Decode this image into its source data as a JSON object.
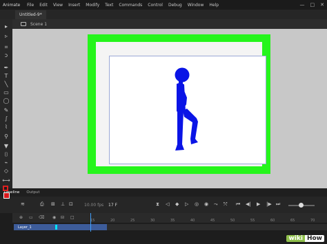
{
  "menu": {
    "app_name": "Animate",
    "items": [
      "File",
      "Edit",
      "View",
      "Insert",
      "Modify",
      "Text",
      "Commands",
      "Control",
      "Debug",
      "Window",
      "Help"
    ],
    "window_controls": {
      "minimize": "—",
      "maximize": "□",
      "close": "✕"
    }
  },
  "document": {
    "tab_title": "Untitled-9*",
    "scene_label": "Scene 1"
  },
  "colors": {
    "stage_frame": "#25f51b",
    "figure": "#0a14e6",
    "stroke_swatch": "#e02020",
    "fill_swatch": "#d8181c",
    "layer_highlight": "#3d5c9a",
    "layer_color_tag": "#00e5ff"
  },
  "tools": [
    {
      "name": "selection-tool",
      "glyph": "▸"
    },
    {
      "name": "subselection-tool",
      "glyph": "▹"
    },
    {
      "name": "free-transform-tool",
      "glyph": "⌗"
    },
    {
      "name": "lasso-tool",
      "glyph": "ↄ"
    },
    {
      "name": "pen-tool",
      "glyph": "✒"
    },
    {
      "name": "text-tool",
      "glyph": "T"
    },
    {
      "name": "line-tool",
      "glyph": "╲"
    },
    {
      "name": "rectangle-tool",
      "glyph": "▭"
    },
    {
      "name": "oval-tool",
      "glyph": "◯"
    },
    {
      "name": "pencil-tool",
      "glyph": "✎"
    },
    {
      "name": "brush-tool",
      "glyph": "∫"
    },
    {
      "name": "paint-brush-tool",
      "glyph": "⌇"
    },
    {
      "name": "bone-tool",
      "glyph": "⚲"
    },
    {
      "name": "paint-bucket-tool",
      "glyph": "▼"
    },
    {
      "name": "ink-bottle-tool",
      "glyph": "⌷"
    },
    {
      "name": "eyedropper-tool",
      "glyph": "⌁"
    },
    {
      "name": "eraser-tool",
      "glyph": "◇"
    },
    {
      "name": "width-tool",
      "glyph": "⟷"
    },
    {
      "name": "camera-tool",
      "glyph": "⎙"
    },
    {
      "name": "hand-tool",
      "glyph": "✋"
    },
    {
      "name": "zoom-tool",
      "glyph": "⚲"
    }
  ],
  "timeline": {
    "tabs": [
      "Timeline",
      "Output"
    ],
    "fps": "10.00 fps",
    "current_frame": "17",
    "frame_suffix": "F",
    "ruler_ticks": [
      "15",
      "20",
      "25",
      "30",
      "35",
      "40",
      "45",
      "50",
      "55",
      "60",
      "65",
      "70"
    ],
    "layer_name": "Layer_1"
  },
  "watermark": {
    "part1": "wiki",
    "part2": "How"
  }
}
